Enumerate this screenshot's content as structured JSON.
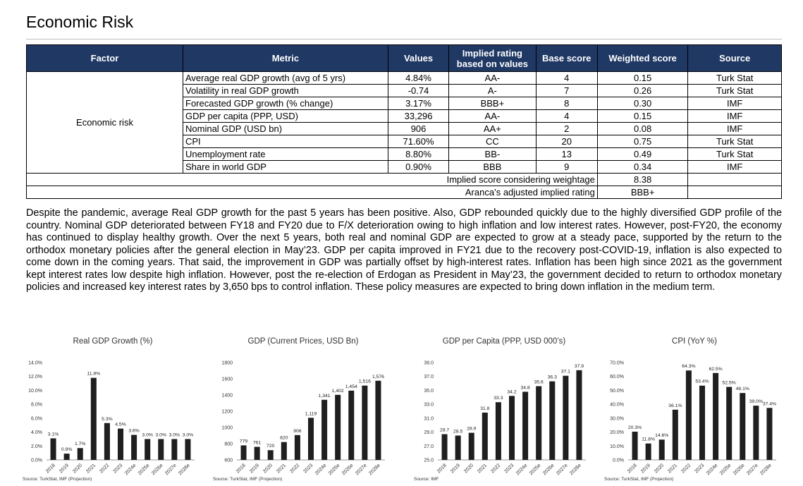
{
  "title": "Economic Risk",
  "table": {
    "headers": [
      "Factor",
      "Metric",
      "Values",
      "Implied rating based on values",
      "Base score",
      "Weighted score",
      "Source"
    ],
    "factor": "Economic risk",
    "rows": [
      {
        "metric": "Average real GDP growth (avg of 5 yrs)",
        "value": "4.84%",
        "rating": "AA-",
        "base": "4",
        "weighted": "0.15",
        "source": "Turk Stat"
      },
      {
        "metric": "Volatility in real GDP growth",
        "value": "-0.74",
        "rating": "A-",
        "base": "7",
        "weighted": "0.26",
        "source": "Turk Stat"
      },
      {
        "metric": "Forecasted GDP growth (% change)",
        "value": "3.17%",
        "rating": "BBB+",
        "base": "8",
        "weighted": "0.30",
        "source": "IMF"
      },
      {
        "metric": "GDP per capita (PPP, USD)",
        "value": "33,296",
        "rating": "AA-",
        "base": "4",
        "weighted": "0.15",
        "source": "IMF"
      },
      {
        "metric": "Nominal GDP (USD bn)",
        "value": "906",
        "rating": "AA+",
        "base": "2",
        "weighted": "0.08",
        "source": "IMF"
      },
      {
        "metric": "CPI",
        "value": "71.60%",
        "rating": "CC",
        "base": "20",
        "weighted": "0.75",
        "source": "Turk Stat"
      },
      {
        "metric": "Unemployment rate",
        "value": "8.80%",
        "rating": "BB-",
        "base": "13",
        "weighted": "0.49",
        "source": "Turk Stat"
      },
      {
        "metric": "Share in world GDP",
        "value": "0.90%",
        "rating": "BBB",
        "base": "9",
        "weighted": "0.34",
        "source": "IMF"
      }
    ],
    "implied_label": "Implied score considering weightage",
    "implied_value": "8.38",
    "adjusted_label": "Aranca’s adjusted implied rating",
    "adjusted_value": "BBB+"
  },
  "paragraph": "Despite the pandemic, average Real GDP growth for the past 5 years has been positive. Also, GDP rebounded quickly due to the highly diversified GDP profile of the country. Nominal GDP deteriorated between FY18 and FY20 due to F/X deterioration owing to high inflation and low interest rates. However, post-FY20, the economy has continued to display healthy growth. Over the next 5 years, both real and nominal GDP are expected to grow at a steady pace, supported by the return to the orthodox monetary policies after the general election in May’23. GDP per capita improved in FY21 due to the recovery post-COVID-19, inflation is also expected to come down in the coming years. That said, the improvement in GDP was partially offset by high-interest rates. Inflation has been high since 2021 as the government kept interest rates low despite high inflation. However, post the re-election of Erdogan as President in May’23, the government decided to return to orthodox monetary policies and increased key interest rates by 3,650 bps to control inflation. These policy measures are expected to bring down inflation in the medium term.",
  "bar_color": "#1f1f1f",
  "chart_data": [
    {
      "type": "bar",
      "title": "Real GDP Growth (%)",
      "categories": [
        "2018",
        "2019",
        "2020",
        "2021",
        "2022",
        "2023",
        "2024e",
        "2025e",
        "2026e",
        "2027e",
        "2028e"
      ],
      "values": [
        3.1,
        0.9,
        1.7,
        11.8,
        5.3,
        4.5,
        3.6,
        3.0,
        3.0,
        3.0,
        3.0
      ],
      "labels": [
        "3.1%",
        "0.9%",
        "1.7%",
        "11.8%",
        "5.3%",
        "4.5%",
        "3.6%",
        "3.0%",
        "3.0%",
        "3.0%",
        "3.0%"
      ],
      "ylim": [
        0,
        14
      ],
      "yticks": [
        "0.0%",
        "2.0%",
        "4.0%",
        "6.0%",
        "8.0%",
        "10.0%",
        "12.0%",
        "14.0%"
      ],
      "source": "Source: TurkStat, IMF (Projection)"
    },
    {
      "type": "bar",
      "title": "GDP (Current Prices, USD Bn)",
      "categories": [
        "2018",
        "2019",
        "2020",
        "2021",
        "2022",
        "2023",
        "2024e",
        "2025e",
        "2026e",
        "2027e",
        "2028e"
      ],
      "values": [
        779,
        761,
        720,
        820,
        906,
        1119,
        1341,
        1402,
        1454,
        1516,
        1576
      ],
      "labels": [
        "779",
        "761",
        "720",
        "820",
        "906",
        "1,119",
        "1,341",
        "1,402",
        "1,454",
        "1,516",
        "1,576"
      ],
      "ylim": [
        600,
        1800
      ],
      "yticks": [
        "600",
        "800",
        "1000",
        "1200",
        "1400",
        "1600",
        "1800"
      ],
      "source": "Source: TurkStat, IMF (Projection)"
    },
    {
      "type": "bar",
      "title": "GDP per Capita (PPP, USD 000’s)",
      "categories": [
        "2018",
        "2019",
        "2020",
        "2021",
        "2022",
        "2023",
        "2024e",
        "2025e",
        "2026e",
        "2027e",
        "2028e"
      ],
      "values": [
        28.7,
        28.5,
        28.9,
        31.8,
        33.3,
        34.2,
        34.8,
        35.6,
        36.3,
        37.1,
        37.9
      ],
      "labels": [
        "28.7",
        "28.5",
        "28.9",
        "31.8",
        "33.3",
        "34.2",
        "34.8",
        "35.6",
        "36.3",
        "37.1",
        "37.9"
      ],
      "ylim": [
        25,
        39
      ],
      "yticks": [
        "25.0",
        "27.0",
        "29.0",
        "31.0",
        "33.0",
        "35.0",
        "37.0",
        "39.0"
      ],
      "source": "Source: IMF"
    },
    {
      "type": "bar",
      "title": "CPI (YoY %)",
      "categories": [
        "2018",
        "2019",
        "2020",
        "2021",
        "2022",
        "2023",
        "2024e",
        "2025e",
        "2026e",
        "2027e",
        "2028e"
      ],
      "values": [
        20.3,
        11.8,
        14.6,
        36.1,
        64.3,
        53.4,
        62.5,
        52.5,
        48.1,
        39.0,
        37.4
      ],
      "labels": [
        "20.3%",
        "11.8%",
        "14.6%",
        "36.1%",
        "64.3%",
        "53.4%",
        "62.5%",
        "52.5%",
        "48.1%",
        "39.0%",
        "37.4%"
      ],
      "ylim": [
        0,
        70
      ],
      "yticks": [
        "0.0%",
        "10.0%",
        "20.0%",
        "30.0%",
        "40.0%",
        "50.0%",
        "60.0%",
        "70.0%"
      ],
      "source": "Source: TurkStat, IMF (Projection)"
    }
  ]
}
